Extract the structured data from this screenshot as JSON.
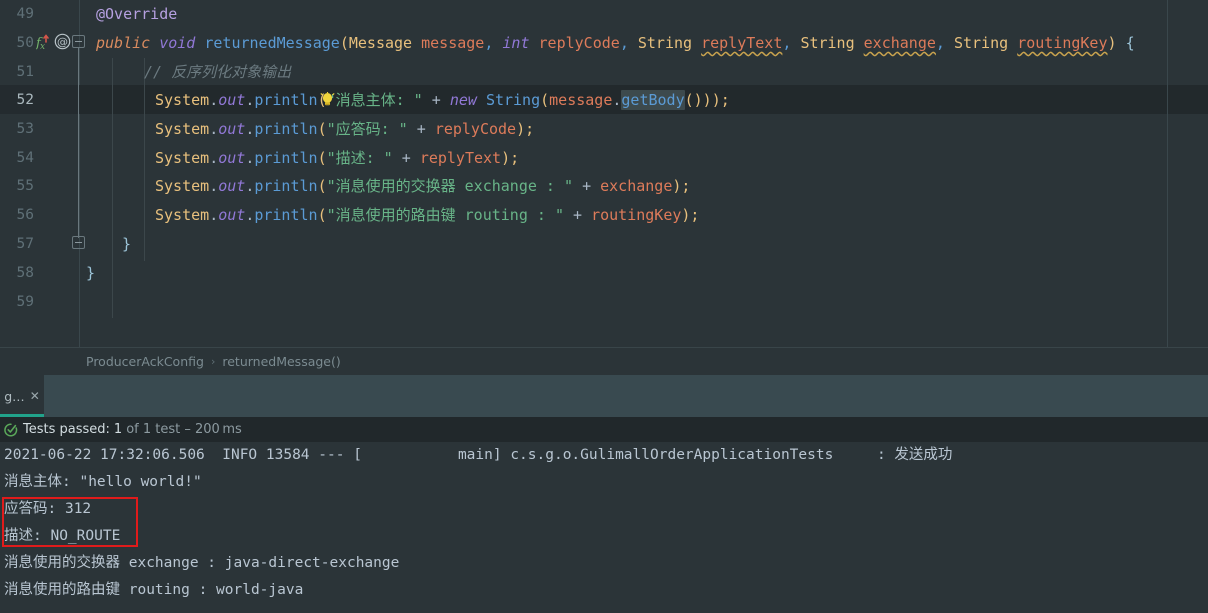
{
  "editor": {
    "lines": [
      {
        "num": "49",
        "indent": 0
      },
      {
        "num": "50",
        "indent": 0
      },
      {
        "num": "51",
        "indent": 0
      },
      {
        "num": "52",
        "indent": 0
      },
      {
        "num": "53",
        "indent": 0
      },
      {
        "num": "54",
        "indent": 0
      },
      {
        "num": "55",
        "indent": 0
      },
      {
        "num": "56",
        "indent": 0
      },
      {
        "num": "57",
        "indent": 0
      },
      {
        "num": "58",
        "indent": 0
      },
      {
        "num": "59",
        "indent": 0
      }
    ],
    "current_line": "52",
    "code": {
      "l49_annotation": "@Override",
      "l50_kw_public": "public",
      "l50_kw_void": "void",
      "l50_method": "returnedMessage",
      "l50_type_message": "Message",
      "l50_param_message": "message",
      "l50_type_int": "int",
      "l50_param_replycode": "replyCode",
      "l50_type_string1": "String",
      "l50_param_replytext": "replyText",
      "l50_type_string2": "String",
      "l50_param_exchange": "exchange",
      "l50_type_string3": "String",
      "l50_param_routingkey": "routingKey",
      "l51_comment": "// 反序列化对象输出",
      "l52_str": "\"消息主体: \"",
      "l52_kw_new": "new",
      "l52_class_string": "String",
      "l52_obj": "message",
      "l52_method_getbody": "getBody",
      "l53_str": "\"应答码: \"",
      "l53_arg": "replyCode",
      "l54_str": "\"描述: \"",
      "l54_arg": "replyText",
      "l55_str": "\"消息使用的交换器 exchange : \"",
      "l55_arg": "exchange",
      "l56_str": "\"消息使用的路由键 routing : \"",
      "l56_arg": "routingKey",
      "sysout_system": "System",
      "sysout_out": "out",
      "sysout_println": "println",
      "close_brace_57": "}",
      "close_brace_58": "}"
    }
  },
  "breadcrumb": {
    "class": "ProducerAckConfig",
    "separator": "›",
    "method": "returnedMessage()"
  },
  "run_panel": {
    "tab_label": "g…",
    "tab_close": "✕",
    "test_status": {
      "label": "Tests passed:",
      "count": "1",
      "detail": "of 1 test – 200 ms"
    },
    "console_lines": [
      "2021-06-22 17:32:06.506  INFO 13584 --- [           main] c.s.g.o.GulimallOrderApplicationTests     : 发送成功",
      "消息主体: \"hello world!\"",
      "应答码: 312",
      "描述: NO_ROUTE",
      "消息使用的交换器 exchange : java-direct-exchange",
      "消息使用的路由键 routing : world-java"
    ]
  },
  "colors": {
    "editor_bg": "#2b3438",
    "current_line_bg": "#22292c",
    "tabrow_bg": "#394a50",
    "testbar_bg": "#21282b",
    "accent_teal": "#21a38b",
    "highlight_red": "#e01b1b",
    "string_green": "#68b488",
    "keyword_orange": "#d98b5f",
    "keyword_violet": "#9178d6",
    "method_blue": "#5b9bd5",
    "type_gold": "#e8c07d",
    "param_salmon": "#dd7b5a",
    "comment_grey": "#6b7a80"
  }
}
